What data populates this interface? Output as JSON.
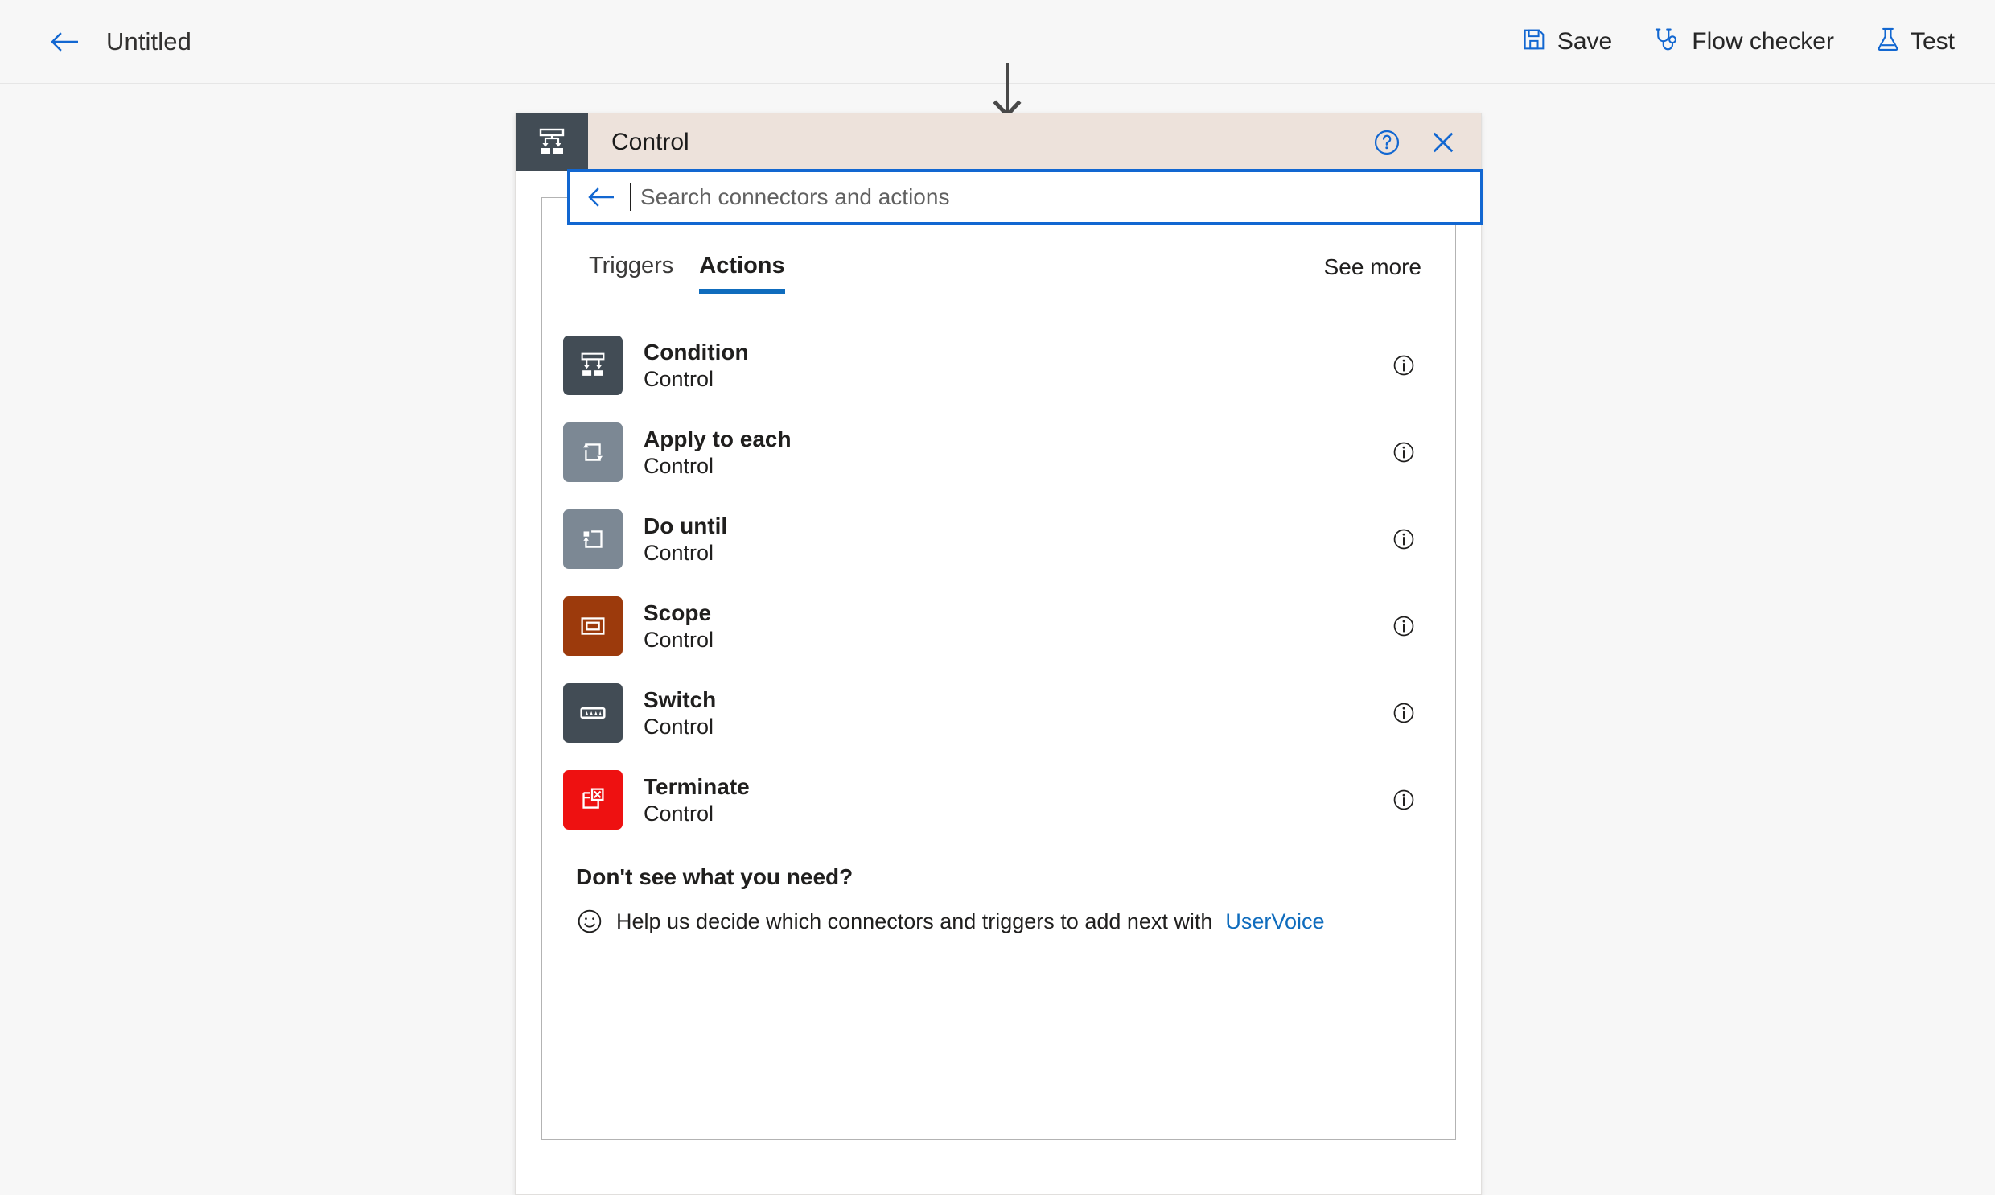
{
  "topbar": {
    "back_icon": "back-arrow-icon",
    "title": "Untitled",
    "commands": [
      {
        "label": "Save",
        "icon": "save-floppy-icon"
      },
      {
        "label": "Flow checker",
        "icon": "stethoscope-icon"
      },
      {
        "label": "Test",
        "icon": "flask-icon"
      }
    ]
  },
  "canvas": {
    "connector_icon": "down-arrow-icon"
  },
  "panel": {
    "header": {
      "title": "Control",
      "icon": "control-condition-icon",
      "icon_tile_color": "#424c55",
      "bar_color": "#ede2db",
      "help_icon": "help-circle-icon",
      "close_icon": "close-x-icon"
    },
    "search": {
      "back_icon": "back-arrow-icon",
      "placeholder": "Search connectors and actions",
      "value": "",
      "focus_color": "#1267d1"
    },
    "tabs": [
      {
        "label": "Triggers",
        "active": false
      },
      {
        "label": "Actions",
        "active": true
      }
    ],
    "see_more_label": "See more",
    "actions": [
      {
        "name": "Condition",
        "subtitle": "Control",
        "icon": "condition-icon",
        "tile_color": "#424c55",
        "info_icon": "info-circle-icon"
      },
      {
        "name": "Apply to each",
        "subtitle": "Control",
        "icon": "loop-icon",
        "tile_color": "#7c8894",
        "info_icon": "info-circle-icon"
      },
      {
        "name": "Do until",
        "subtitle": "Control",
        "icon": "do-until-icon",
        "tile_color": "#7c8894",
        "info_icon": "info-circle-icon"
      },
      {
        "name": "Scope",
        "subtitle": "Control",
        "icon": "scope-icon",
        "tile_color": "#9c3a0c",
        "info_icon": "info-circle-icon"
      },
      {
        "name": "Switch",
        "subtitle": "Control",
        "icon": "switch-icon",
        "tile_color": "#424c55",
        "info_icon": "info-circle-icon"
      },
      {
        "name": "Terminate",
        "subtitle": "Control",
        "icon": "terminate-icon",
        "tile_color": "#ee1111",
        "info_icon": "info-circle-icon"
      }
    ],
    "footer": {
      "heading": "Don't see what you need?",
      "smiley_icon": "smiley-face-icon",
      "text": "Help us decide which connectors and triggers to add next with",
      "link_label": "UserVoice",
      "link_color": "#0f6cbd"
    }
  }
}
